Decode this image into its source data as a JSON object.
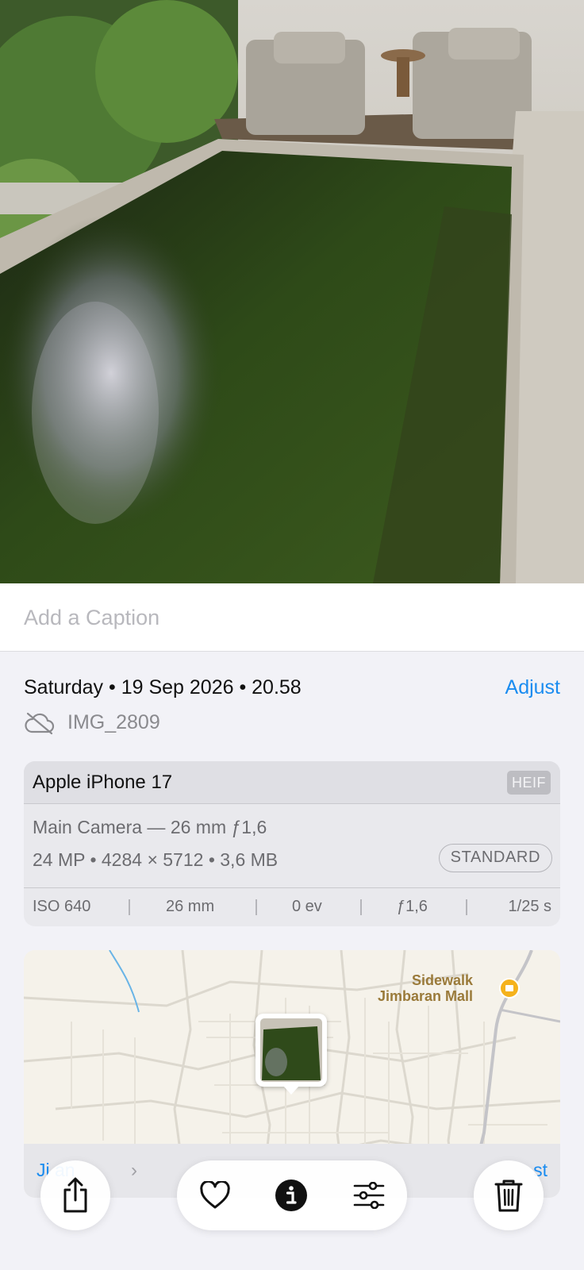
{
  "caption": {
    "placeholder": "Add a Caption"
  },
  "date_line": "Saturday • 19 Sep 2026 • 20.58",
  "adjust_label": "Adjust",
  "file": {
    "name": "IMG_2809",
    "icon": "cloud-slash-icon"
  },
  "camera": {
    "device": "Apple iPhone 17",
    "format": "HEIF",
    "lens": "Main Camera — 26 mm ƒ1,6",
    "specs": "24 MP • 4284 × 5712 • 3,6 MB",
    "mode": "STANDARD",
    "exif": [
      "ISO 640",
      "26 mm",
      "0 ev",
      "ƒ1,6",
      "1/25 s"
    ]
  },
  "map": {
    "poi_name_line1": "Sidewalk",
    "poi_name_line2": "Jimbaran Mall",
    "location_label": "Ji     an",
    "right_link": "st"
  },
  "toolbar": {
    "share_icon": "share-icon",
    "favorite_icon": "heart-icon",
    "info_icon": "info-icon",
    "adjust_icon": "sliders-icon",
    "delete_icon": "trash-icon"
  },
  "colors": {
    "accent": "#1a8cf0",
    "background": "#f2f2f7"
  }
}
